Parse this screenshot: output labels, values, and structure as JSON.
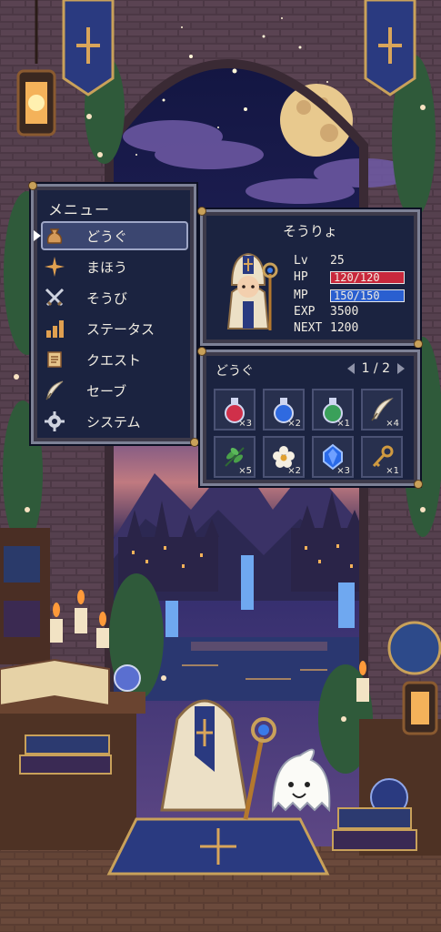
{
  "menu": {
    "title": "メニュー",
    "items": [
      {
        "label": "どうぐ",
        "icon": "bag-icon",
        "selected": true
      },
      {
        "label": "まほう",
        "icon": "sparkle-icon",
        "selected": false
      },
      {
        "label": "そうび",
        "icon": "crossed-swords-icon",
        "selected": false
      },
      {
        "label": "ステータス",
        "icon": "bar-chart-icon",
        "selected": false
      },
      {
        "label": "クエスト",
        "icon": "scroll-icon",
        "selected": false
      },
      {
        "label": "セーブ",
        "icon": "quill-icon",
        "selected": false
      },
      {
        "label": "システム",
        "icon": "gear-icon",
        "selected": false
      }
    ]
  },
  "status": {
    "name": "そうりょ",
    "lv_label": "Lv",
    "lv": "25",
    "hp_label": "HP",
    "hp": "120/120",
    "mp_label": "MP",
    "mp": "150/150",
    "exp_label": "EXP",
    "exp": "3500",
    "next_label": "NEXT",
    "next": "1200"
  },
  "inventory": {
    "title": "どうぐ",
    "page": "1 / 2",
    "items": [
      {
        "icon": "red-potion-icon",
        "qty": "×3"
      },
      {
        "icon": "blue-potion-icon",
        "qty": "×2"
      },
      {
        "icon": "green-potion-icon",
        "qty": "×1"
      },
      {
        "icon": "feather-icon",
        "qty": "×4"
      },
      {
        "icon": "herb-leaf-icon",
        "qty": "×5"
      },
      {
        "icon": "white-flower-icon",
        "qty": "×2"
      },
      {
        "icon": "blue-crystal-icon",
        "qty": "×3"
      },
      {
        "icon": "key-icon",
        "qty": "×1"
      }
    ]
  },
  "colors": {
    "panel_bg": "#1b2340",
    "hp_bar": "#c8283c",
    "mp_bar": "#2a5fd0",
    "night_sky": "#16194a",
    "moon": "#e8c98e"
  }
}
